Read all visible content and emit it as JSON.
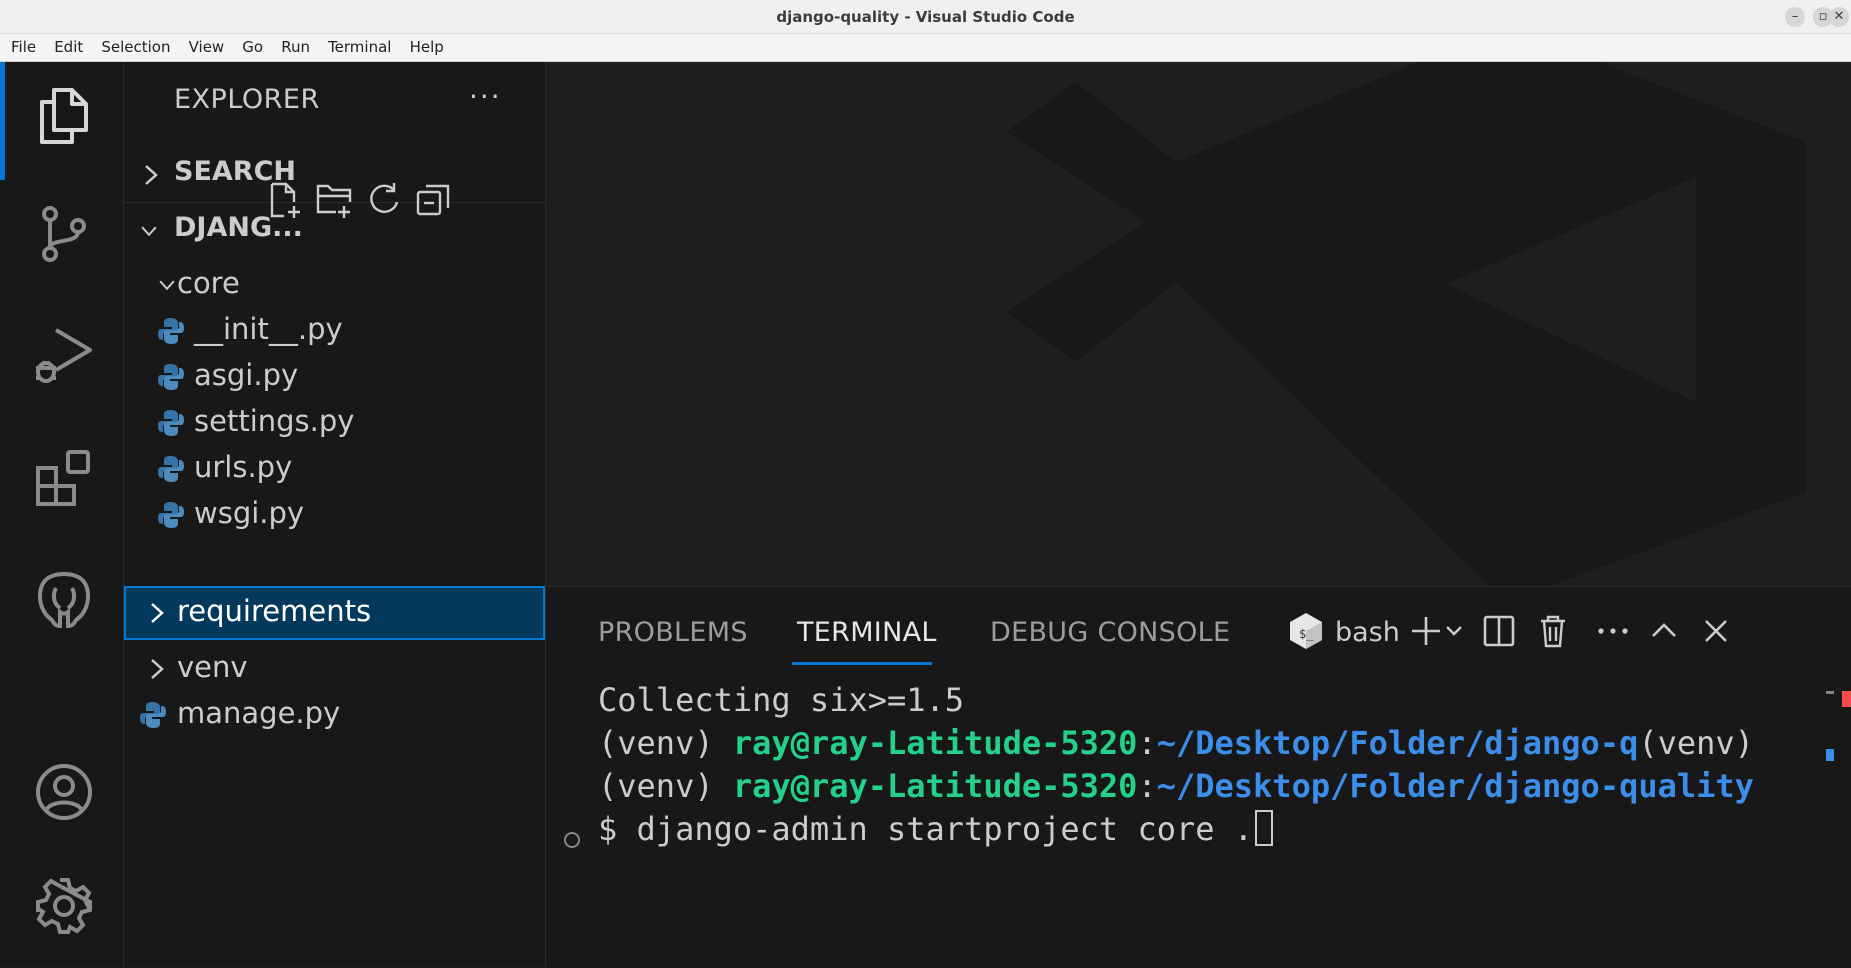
{
  "window": {
    "title": "django-quality - Visual Studio Code",
    "minimize": "–",
    "restore": "▫",
    "close": "✕"
  },
  "menu": [
    "File",
    "Edit",
    "Selection",
    "View",
    "Go",
    "Run",
    "Terminal",
    "Help"
  ],
  "activity_bar": {
    "items": [
      "files-icon",
      "source-control-icon",
      "run-debug-icon",
      "extensions-icon",
      "postgres-elephant-icon"
    ],
    "bottom": [
      "account-icon",
      "manage-gear-icon"
    ],
    "accent": "#0078d4"
  },
  "explorer": {
    "title": "EXPLORER",
    "more": "···",
    "sections": {
      "search": "SEARCH",
      "folder": "DJANG..."
    },
    "tree": [
      {
        "label": "core",
        "type": "folder-open"
      },
      {
        "label": "__init__.py",
        "type": "python-file"
      },
      {
        "label": "asgi.py",
        "type": "python-file"
      },
      {
        "label": "settings.py",
        "type": "python-file"
      },
      {
        "label": "urls.py",
        "type": "python-file"
      },
      {
        "label": "wsgi.py",
        "type": "python-file"
      },
      {
        "label": "requirements",
        "type": "folder-closed",
        "selected": true
      },
      {
        "label": "venv",
        "type": "folder-closed"
      },
      {
        "label": "manage.py",
        "type": "python-file"
      }
    ]
  },
  "panel": {
    "tabs": {
      "problems": "PROBLEMS",
      "terminal": "TERMINAL",
      "debug": "DEBUG CONSOLE"
    },
    "active_tab": "TERMINAL",
    "shell": "bash",
    "more": "···"
  },
  "terminal": {
    "line1": "Collecting six>=1.5",
    "line2": {
      "prefix": "(venv) ",
      "user": "ray@ray-Latitude-5320",
      "colon": ":",
      "path": "~/Desktop/Folder/django-q",
      "suffix": "(venv)"
    },
    "line3": {
      "prefix": "(venv) ",
      "user": "ray@ray-Latitude-5320",
      "colon": ":",
      "path": "~/Desktop/Folder/django-quality"
    },
    "line4": "$ django-admin startproject core ."
  },
  "colors": {
    "user_green": "#23d18b",
    "path_blue": "#3b8eea",
    "selected_bg": "#04395e"
  }
}
